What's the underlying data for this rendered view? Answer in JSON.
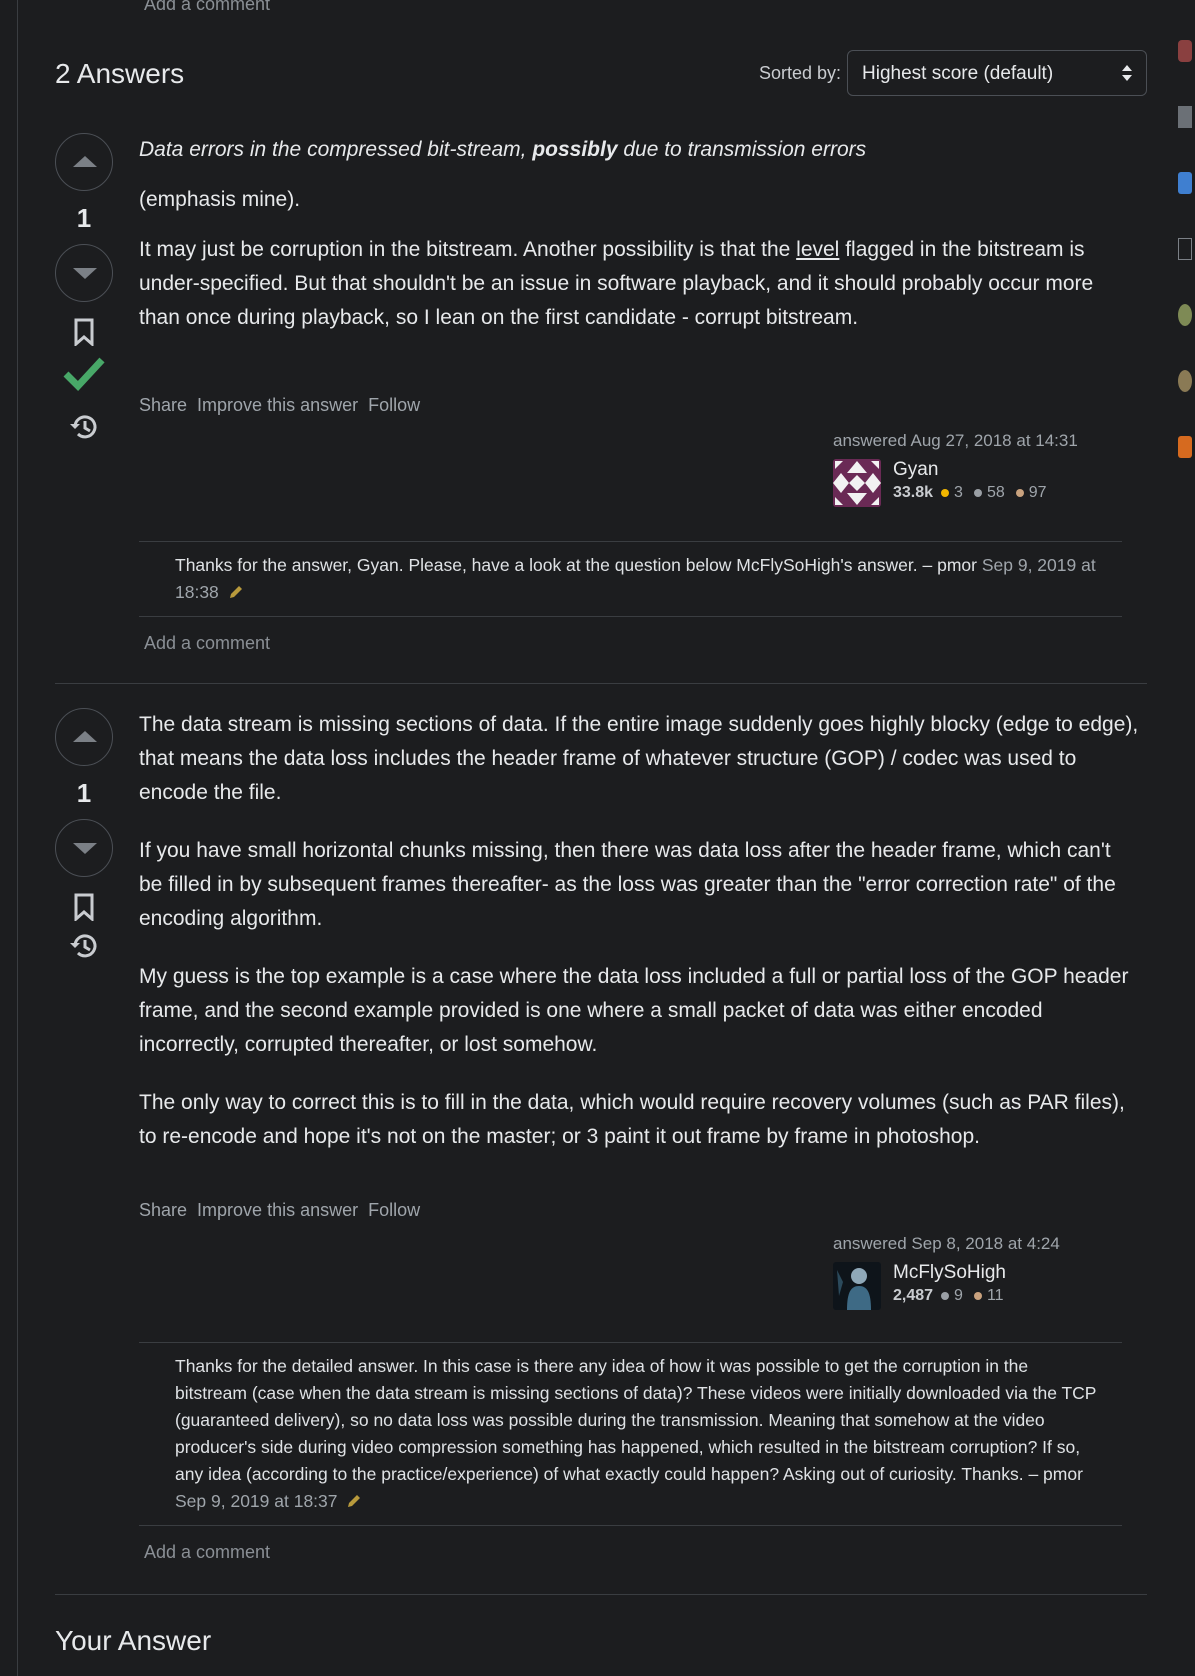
{
  "top": {
    "add_comment": "Add a comment"
  },
  "answers_header": {
    "title": "2 Answers",
    "sort_label": "Sorted by:",
    "sort_value": "Highest score (default)"
  },
  "answers": [
    {
      "score": "1",
      "accepted": true,
      "paragraphs": {
        "p1_a": "Data errors in the compressed bit-stream, ",
        "p1_b": "possibly",
        "p1_c": " due to transmission errors",
        "p2": "(emphasis mine).",
        "p3_a": "It may just be corruption in the bitstream. Another possibility is that the ",
        "p3_link": "level",
        "p3_b": " flagged in the bitstream is under-specified. But that shouldn't be an issue in software playback, and it should probably occur more than once during playback, so I lean on the first candidate - corrupt bitstream."
      },
      "menu": {
        "share": "Share",
        "improve": "Improve this answer",
        "follow": "Follow"
      },
      "user": {
        "answered": "answered Aug 27, 2018 at 14:31",
        "name": "Gyan",
        "rep": "33.8k",
        "gold": "3",
        "silver": "58",
        "bronze": "97"
      },
      "comment": {
        "text": "Thanks for the answer, Gyan. Please, have a look at the question below McFlySoHigh's answer. – ",
        "author": "pmor",
        "date": "Sep 9, 2019 at 18:38"
      },
      "add_comment": "Add a comment"
    },
    {
      "score": "1",
      "accepted": false,
      "paragraphs": {
        "p1": "The data stream is missing sections of data. If the entire image suddenly goes highly blocky (edge to edge), that means the data loss includes the header frame of whatever structure (GOP) / codec was used to encode the file.",
        "p2": "If you have small horizontal chunks missing, then there was data loss after the header frame, which can't be filled in by subsequent frames thereafter- as the loss was greater than the \"error correction rate\" of the encoding algorithm.",
        "p3": "My guess is the top example is a case where the data loss included a full or partial loss of the GOP header frame, and the second example provided is one where a small packet of data was either encoded incorrectly, corrupted thereafter, or lost somehow.",
        "p4": "The only way to correct this is to fill in the data, which would require recovery volumes (such as PAR files), to re-encode and hope it's not on the master; or 3 paint it out frame by frame in photoshop."
      },
      "menu": {
        "share": "Share",
        "improve": "Improve this answer",
        "follow": "Follow"
      },
      "user": {
        "answered": "answered Sep 8, 2018 at 4:24",
        "name": "McFlySoHigh",
        "rep": "2,487",
        "silver": "9",
        "bronze": "11"
      },
      "comment": {
        "text": "Thanks for the detailed answer. In this case is there any idea of how it was possible to get the corruption in the bitstream (case when the data stream is missing sections of data)? These videos were initially downloaded via the TCP (guaranteed delivery), so no data loss was possible during the transmission. Meaning that somehow at the video producer's side during video compression something has happened, which resulted in the bitstream corruption? If so, any idea (according to the practice/experience) of what exactly could happen? Asking out of curiosity. Thanks. – ",
        "author": "pmor",
        "date": "Sep 9, 2019 at 18:37"
      },
      "add_comment": "Add a comment"
    }
  ],
  "your_answer": "Your Answer",
  "colors": {
    "background": "#1c1d1f",
    "text": "#e7e9eb",
    "muted": "#9fa5ab",
    "border": "#3a3d41",
    "accepted_check": "#48a868",
    "gold": "#f1b600",
    "silver": "#9a9fa5",
    "bronze": "#c9a27e"
  },
  "icons": [
    "upvote-icon",
    "downvote-icon",
    "bookmark-icon",
    "accepted-check-icon",
    "history-icon",
    "edit-pencil-icon",
    "sort-caret-icon"
  ]
}
